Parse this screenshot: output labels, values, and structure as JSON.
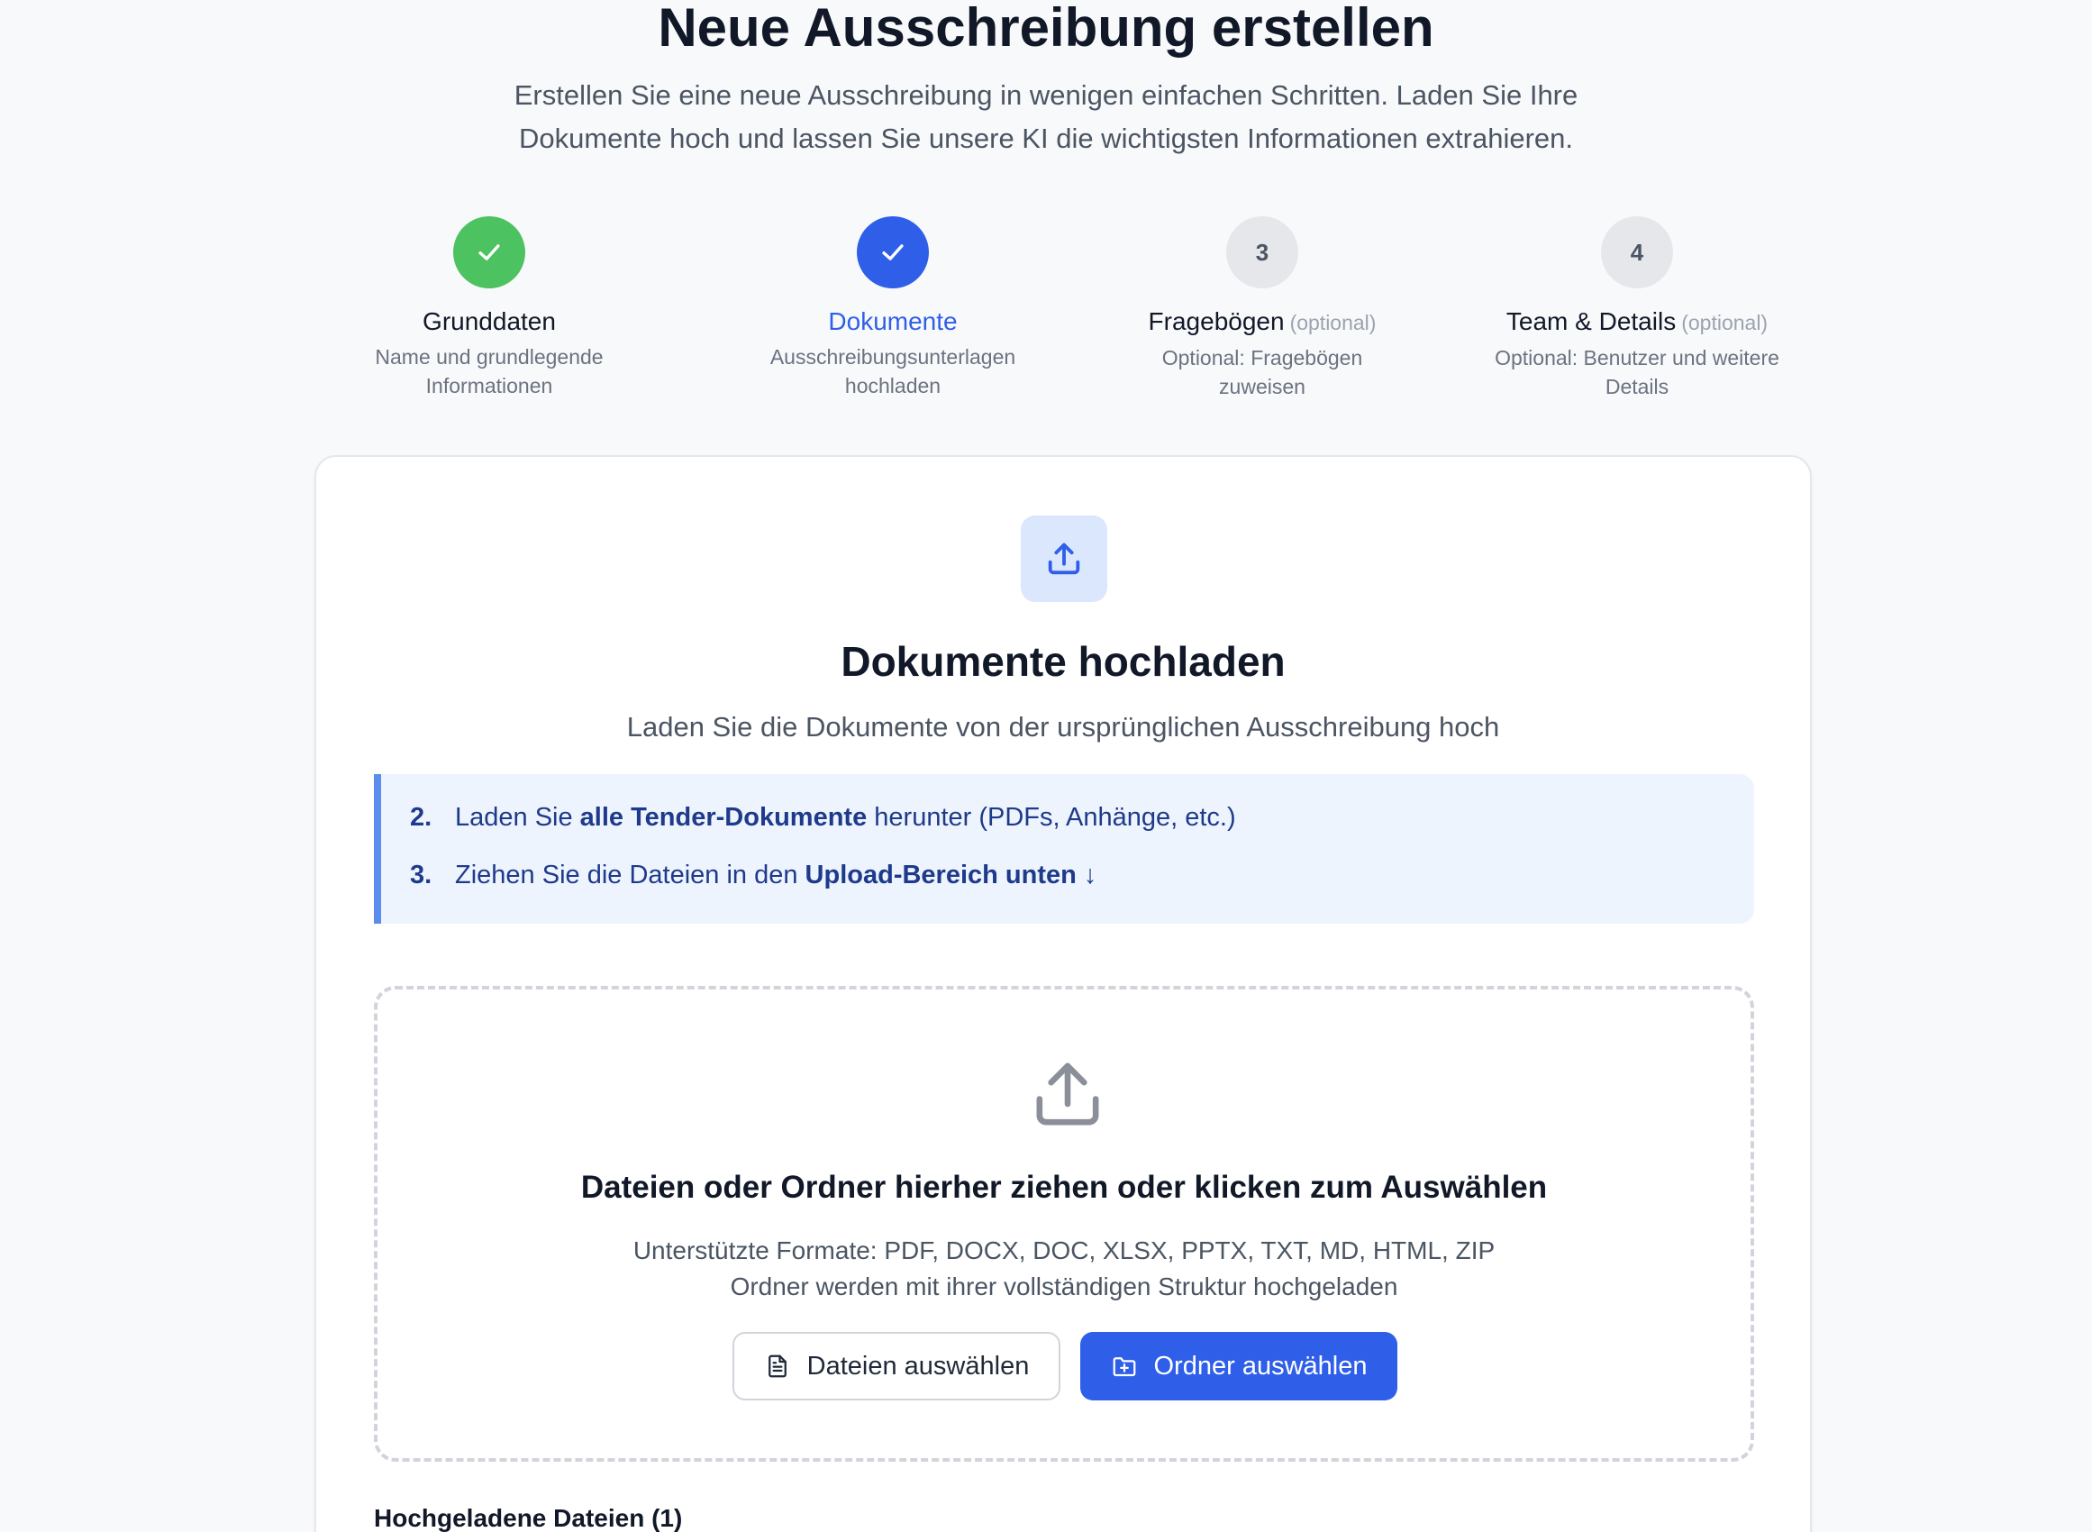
{
  "page": {
    "title": "Neue Ausschreibung erstellen",
    "subtitle_line1": "Erstellen Sie eine neue Ausschreibung in wenigen einfachen Schritten. Laden Sie Ihre",
    "subtitle_line2": "Dokumente hoch und lassen Sie unsere KI die wichtigsten Informationen extrahieren."
  },
  "steps": [
    {
      "number": "",
      "status": "done",
      "title": "Grunddaten",
      "optional": "",
      "desc_line1": "Name und grundlegende",
      "desc_line2": "Informationen"
    },
    {
      "number": "",
      "status": "active",
      "title": "Dokumente",
      "optional": "",
      "desc_line1": "Ausschreibungsunterlagen",
      "desc_line2": "hochladen"
    },
    {
      "number": "3",
      "status": "todo",
      "title": "Fragebögen",
      "optional": "(optional)",
      "desc_line1": "Optional: Fragebögen",
      "desc_line2": "zuweisen"
    },
    {
      "number": "4",
      "status": "todo",
      "title": "Team & Details",
      "optional": "(optional)",
      "desc_line1": "Optional: Benutzer und weitere",
      "desc_line2": "Details"
    }
  ],
  "card": {
    "title": "Dokumente hochladen",
    "subtitle": "Laden Sie die Dokumente von der ursprünglichen Ausschreibung hoch",
    "info": [
      {
        "num": "2.",
        "pre": "Laden Sie ",
        "bold": "alle Tender-Dokumente",
        "post": " herunter (PDFs, Anhänge, etc.)"
      },
      {
        "num": "3.",
        "pre": "Ziehen Sie die Dateien in den ",
        "bold": "Upload-Bereich unten",
        "post": " ↓"
      }
    ],
    "dropzone": {
      "title": "Dateien oder Ordner hierher ziehen oder klicken zum Auswählen",
      "formats": "Unterstützte Formate: PDF, DOCX, DOC, XLSX, PPTX, TXT, MD, HTML, ZIP",
      "folders_note": "Ordner werden mit ihrer vollständigen Struktur hochgeladen",
      "files_button": "Dateien auswählen",
      "folder_button": "Ordner auswählen"
    },
    "uploaded_title": "Hochgeladene Dateien (1)"
  },
  "colors": {
    "done": "#4cc260",
    "active": "#2f5fe8",
    "info_bg": "#eef4fe",
    "info_border": "#5b8def"
  },
  "icons": {
    "step_done": "check-icon",
    "header_upload": "upload-icon",
    "dropzone_upload": "upload-tray-icon",
    "files_button": "file-text-icon",
    "folder_button": "folder-plus-icon"
  }
}
